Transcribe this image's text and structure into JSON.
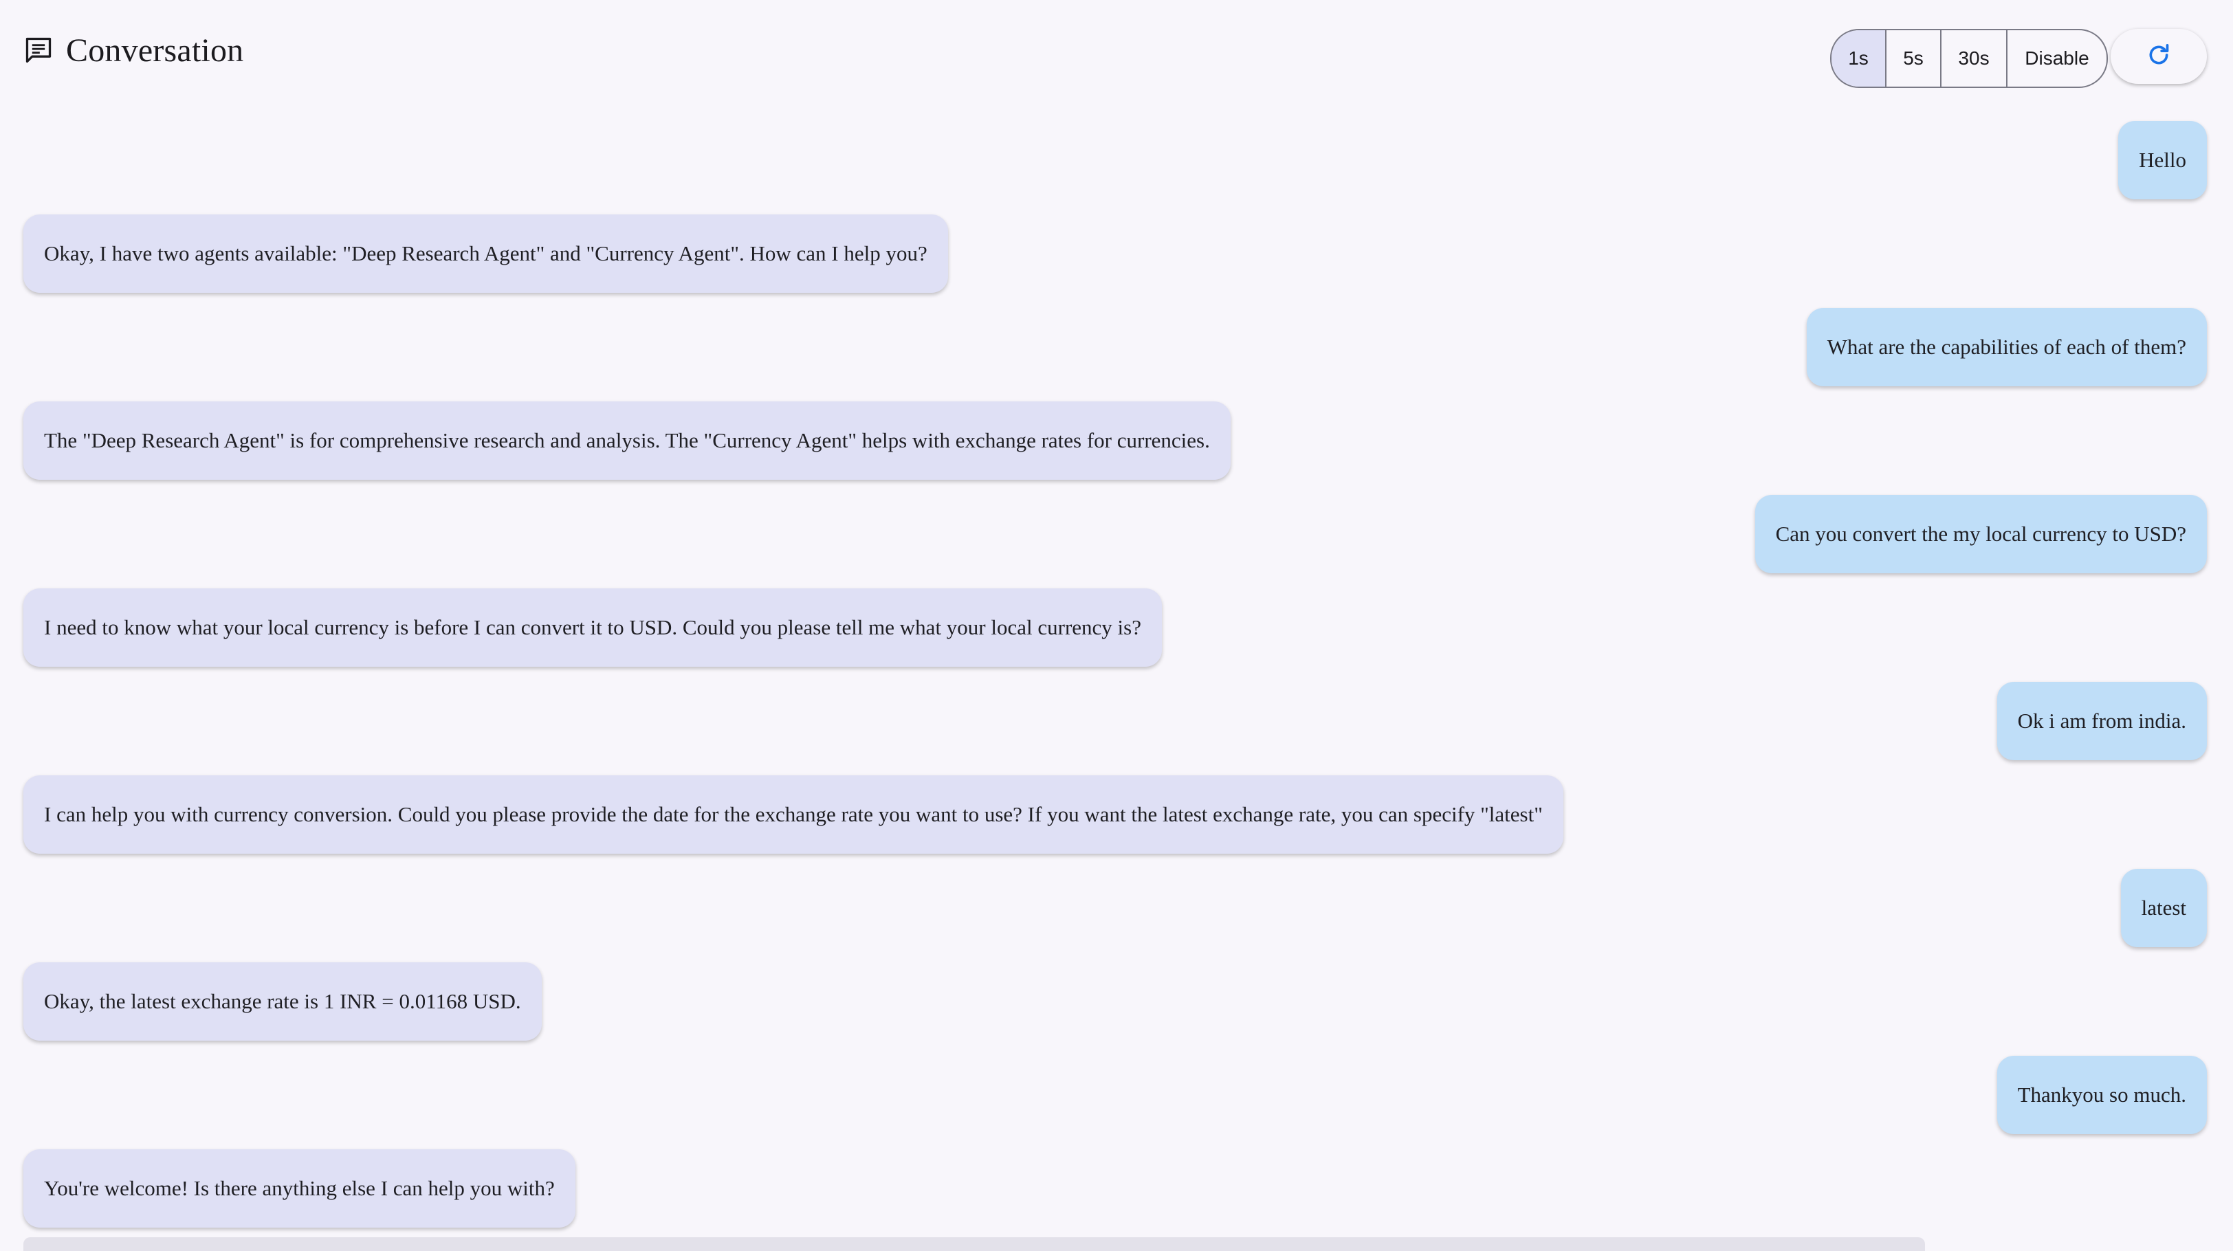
{
  "header": {
    "title": "Conversation",
    "icon": "chat-icon"
  },
  "refresh_options": [
    {
      "label": "1s",
      "selected": true
    },
    {
      "label": "5s",
      "selected": false
    },
    {
      "label": "30s",
      "selected": false
    },
    {
      "label": "Disable",
      "selected": false
    }
  ],
  "refresh_button": {
    "icon": "refresh-icon"
  },
  "messages": [
    {
      "role": "user",
      "text": "Hello"
    },
    {
      "role": "agent",
      "text": "Okay, I have two agents available: \"Deep Research Agent\" and \"Currency Agent\". How can I help you?"
    },
    {
      "role": "user",
      "text": "What are the capabilities of each of them?"
    },
    {
      "role": "agent",
      "text": "The \"Deep Research Agent\" is for comprehensive research and analysis. The \"Currency Agent\" helps with exchange rates for currencies."
    },
    {
      "role": "user",
      "text": "Can you convert the my local currency to USD?"
    },
    {
      "role": "agent",
      "text": "I need to know what your local currency is before I can convert it to USD. Could you please tell me what your local currency is?"
    },
    {
      "role": "user",
      "text": "Ok i am from india."
    },
    {
      "role": "agent",
      "text": "I can help you with currency conversion. Could you please provide the date for the exchange rate you want to use? If you want the latest exchange rate, you can specify \"latest\""
    },
    {
      "role": "user",
      "text": "latest"
    },
    {
      "role": "agent",
      "text": "Okay, the latest exchange rate is 1 INR = 0.01168 USD."
    },
    {
      "role": "user",
      "text": "Thankyou so much."
    },
    {
      "role": "agent",
      "text": "You're welcome! Is there anything else I can help you with?"
    }
  ],
  "colors": {
    "agent_bubble": "#dfe0f5",
    "user_bubble": "#bfdef8",
    "accent": "#1a73e8",
    "background": "#f8f6fb"
  }
}
